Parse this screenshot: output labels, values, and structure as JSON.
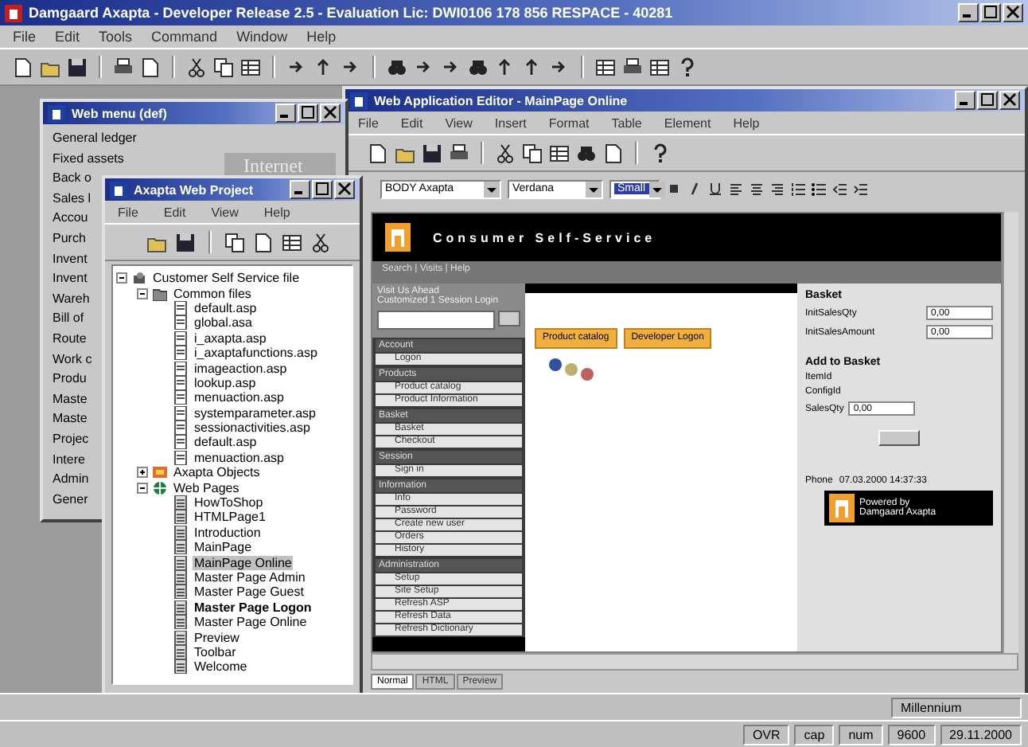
{
  "app": {
    "title": "Damgaard Axapta - Developer Release 2.5 - Evaluation Lic: DWI0106 178 856 RESPACE - 40281",
    "menu": [
      "File",
      "Edit",
      "Tools",
      "Command",
      "Window",
      "Help"
    ]
  },
  "menu_window": {
    "title": "Web menu (def)",
    "label": "Internet",
    "items": [
      "General ledger",
      "Fixed assets",
      "Back o",
      "Sales l",
      "Accou",
      "Purch",
      "Invent",
      "Invent",
      "Wareh",
      "Bill of",
      "Route",
      "Work c",
      "Produ",
      "Maste",
      "Maste",
      "Projec",
      "Intere",
      "Admin",
      "Gener"
    ]
  },
  "project_window": {
    "title": "Axapta Web Project",
    "menu": [
      "File",
      "Edit",
      "View",
      "Help"
    ],
    "tree": [
      {
        "label": "Customer Self Service file",
        "kind": "project",
        "expanded": true,
        "children": [
          {
            "label": "Common files",
            "kind": "folder",
            "expanded": true,
            "children": [
              {
                "label": "default.asp",
                "kind": "file"
              },
              {
                "label": "global.asa",
                "kind": "file"
              },
              {
                "label": "i_axapta.asp",
                "kind": "file"
              },
              {
                "label": "i_axaptafunctions.asp",
                "kind": "file"
              },
              {
                "label": "imageaction.asp",
                "kind": "file"
              },
              {
                "label": "lookup.asp",
                "kind": "file"
              },
              {
                "label": "menuaction.asp",
                "kind": "file"
              },
              {
                "label": "systemparameter.asp",
                "kind": "file"
              },
              {
                "label": "sessionactivities.asp",
                "kind": "file"
              },
              {
                "label": "default.asp",
                "kind": "file"
              },
              {
                "label": "menuaction.asp",
                "kind": "file"
              }
            ]
          },
          {
            "label": "Axapta Objects",
            "kind": "objects",
            "expanded": false
          },
          {
            "label": "Web Pages",
            "kind": "pages",
            "expanded": true,
            "children": [
              {
                "label": "HowToShop",
                "kind": "page",
                "selected": false,
                "default": false
              },
              {
                "label": "HTMLPage1",
                "kind": "page",
                "selected": false,
                "default": false
              },
              {
                "label": "Introduction",
                "kind": "page",
                "selected": false,
                "default": false
              },
              {
                "label": "MainPage",
                "kind": "page",
                "selected": false,
                "default": false
              },
              {
                "label": "MainPage Online",
                "kind": "page",
                "selected": true,
                "default": false
              },
              {
                "label": "Master Page Admin",
                "kind": "page",
                "selected": false,
                "default": false
              },
              {
                "label": "Master Page Guest",
                "kind": "page",
                "selected": false,
                "default": false
              },
              {
                "label": "Master Page Logon",
                "kind": "page",
                "selected": false,
                "default": true
              },
              {
                "label": "Master Page Online",
                "kind": "page",
                "selected": false,
                "default": false
              },
              {
                "label": "Preview",
                "kind": "page",
                "selected": false,
                "default": false
              },
              {
                "label": "Toolbar",
                "kind": "page",
                "selected": false,
                "default": false
              },
              {
                "label": "Welcome",
                "kind": "page",
                "selected": false,
                "default": false
              }
            ]
          }
        ]
      }
    ]
  },
  "editor": {
    "title": "Web Application Editor - MainPage Online",
    "menu": [
      "File",
      "Edit",
      "View",
      "Insert",
      "Format",
      "Table",
      "Element",
      "Help"
    ],
    "style_select": "BODY Axapta",
    "font_select": "Verdana",
    "size_select": "Small",
    "page": {
      "banner": "Consumer Self-Service",
      "nav": "Search  |  Visits  |  Help",
      "intro": [
        "Visit Us Ahead",
        "Customized 1 Session Login"
      ],
      "sections": [
        {
          "heading": "Account",
          "links": [
            "Logon"
          ]
        },
        {
          "heading": "Products",
          "links": [
            "Product catalog",
            "Product Information"
          ]
        },
        {
          "heading": "Basket",
          "links": [
            "Basket",
            "Checkout"
          ]
        },
        {
          "heading": "Session",
          "links": [
            "Sign in"
          ]
        },
        {
          "heading": "Information",
          "links": [
            "Info",
            "Password",
            "Create new user",
            "Orders",
            "History"
          ]
        },
        {
          "heading": "Administration",
          "links": [
            "Setup",
            "Site Setup",
            "Refresh ASP",
            "Refresh Data",
            "Refresh Dictionary"
          ]
        }
      ],
      "canvas_buttons": [
        "Product catalog",
        "Developer Logon"
      ],
      "basket": {
        "heading": "Basket",
        "fields": [
          {
            "label": "InitSalesQty",
            "value": "0,00"
          },
          {
            "label": "InitSalesAmount",
            "value": "0,00"
          }
        ]
      },
      "add": {
        "heading": "Add to Basket",
        "lines": [
          "ItemId",
          "ConfigId"
        ],
        "field": {
          "label": "SalesQty",
          "value": "0,00"
        }
      },
      "phone": "Phone",
      "timestamp": "07.03.2000 14:37:33",
      "powered": [
        "Powered by",
        "Damgaard Axapta"
      ]
    },
    "tabs": [
      {
        "label": "Normal",
        "selected": true
      },
      {
        "label": "HTML",
        "selected": false
      },
      {
        "label": "Preview",
        "selected": false
      }
    ]
  },
  "status_bar": {
    "company": "Millennium",
    "fields": [
      "OVR",
      "cap",
      "num",
      "9600",
      "29.11.2000"
    ]
  }
}
